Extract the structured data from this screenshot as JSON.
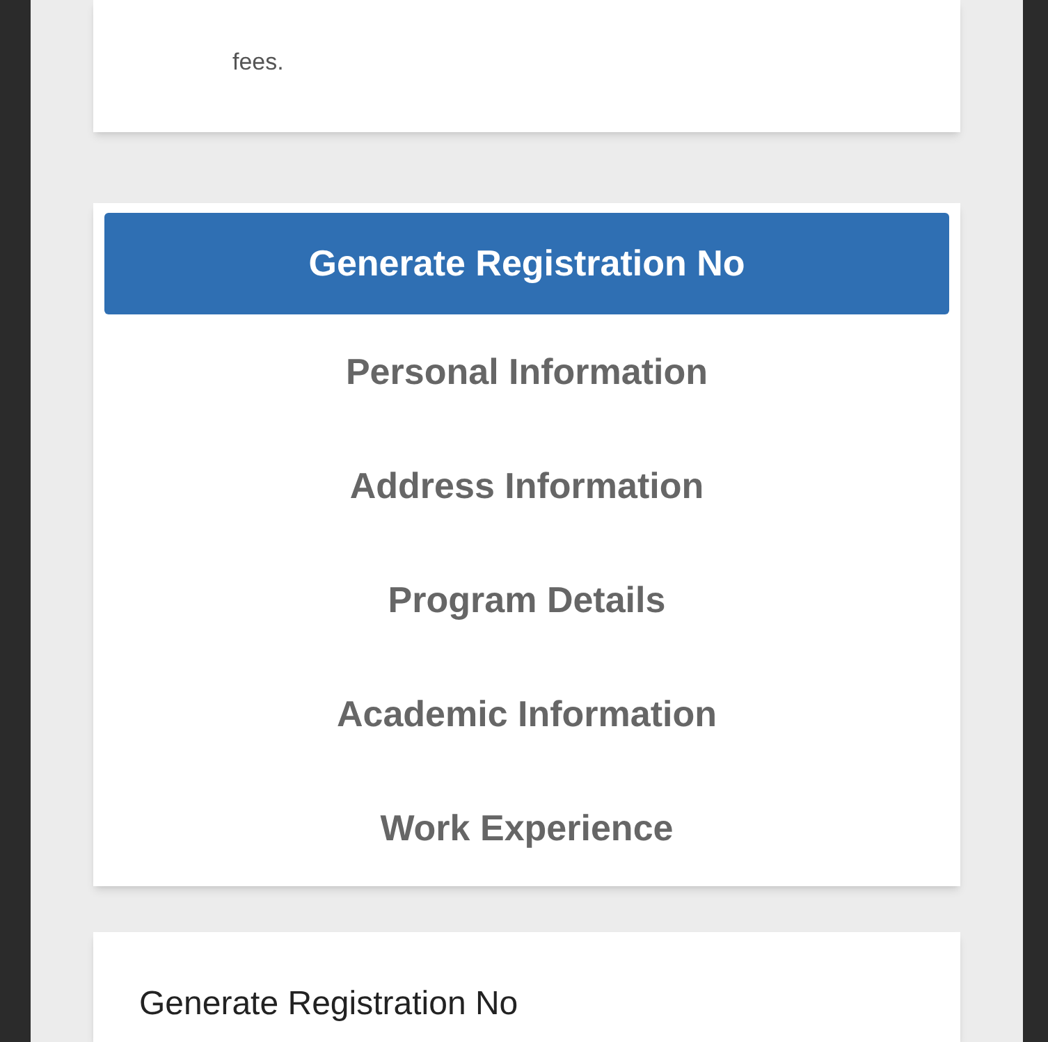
{
  "intro_card": {
    "text": "fees."
  },
  "steps": [
    {
      "label": "Generate Registration No",
      "selected": true
    },
    {
      "label": "Personal Information",
      "selected": false
    },
    {
      "label": "Address Information",
      "selected": false
    },
    {
      "label": "Program Details",
      "selected": false
    },
    {
      "label": "Academic Information",
      "selected": false
    },
    {
      "label": "Work Experience",
      "selected": false
    }
  ],
  "section_card": {
    "title": "Generate Registration No"
  }
}
